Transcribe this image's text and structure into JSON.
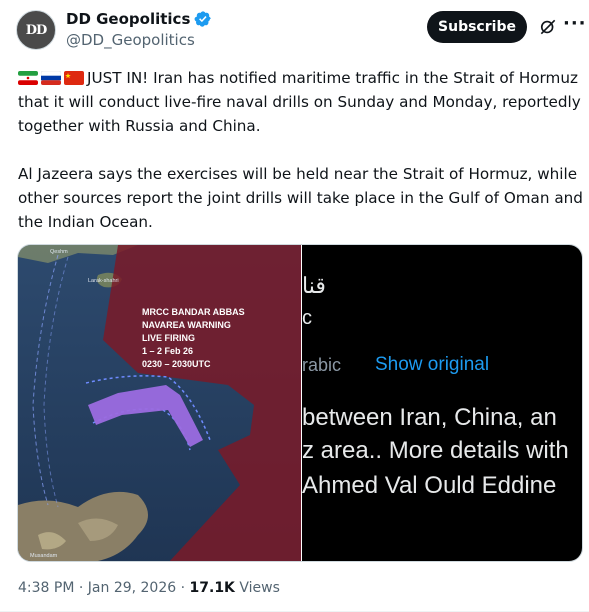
{
  "author": {
    "avatar_text": "DD",
    "name": "DD Geopolitics",
    "handle": "@DD_Geopolitics"
  },
  "actions": {
    "subscribe_label": "Subscribe",
    "more_label": "···"
  },
  "tweet": {
    "paragraph1": "JUST IN! Iran has notified maritime traffic in the Strait of Hormuz that it will conduct live-fire naval drills on Sunday and Monday, reportedly together with Russia and China.",
    "paragraph2": "Al Jazeera says the exercises will be held near the Strait of Hormuz, while other sources report the joint drills will take place in the Gulf of Oman and the Indian Ocean."
  },
  "map": {
    "place1": "Qeshm",
    "place2": "Larak-shahri",
    "place3": "Musandam",
    "notice_line1": "MRCC BANDAR ABBAS",
    "notice_line2": "NAVAREA WARNING",
    "notice_line3": "LIVE FIRING",
    "notice_line4": "1 – 2 Feb 26",
    "notice_line5": "0230 – 2030UTC"
  },
  "translated": {
    "arabic_snippet": "قنا",
    "fragment_c": "c",
    "lang_fragment": "rabic",
    "show_original": "Show original",
    "line1": "between Iran, China, an",
    "line2": "z area.. More details with",
    "line3": "Ahmed Val Ould Eddine"
  },
  "footer": {
    "time": "4:38 PM",
    "date": "Jan 29, 2026",
    "views_count": "17.1K",
    "views_label": "Views"
  },
  "colors": {
    "link_blue": "#1d9bf0",
    "restricted_zone": "#7a1a28",
    "drill_area": "#9b6be0"
  }
}
